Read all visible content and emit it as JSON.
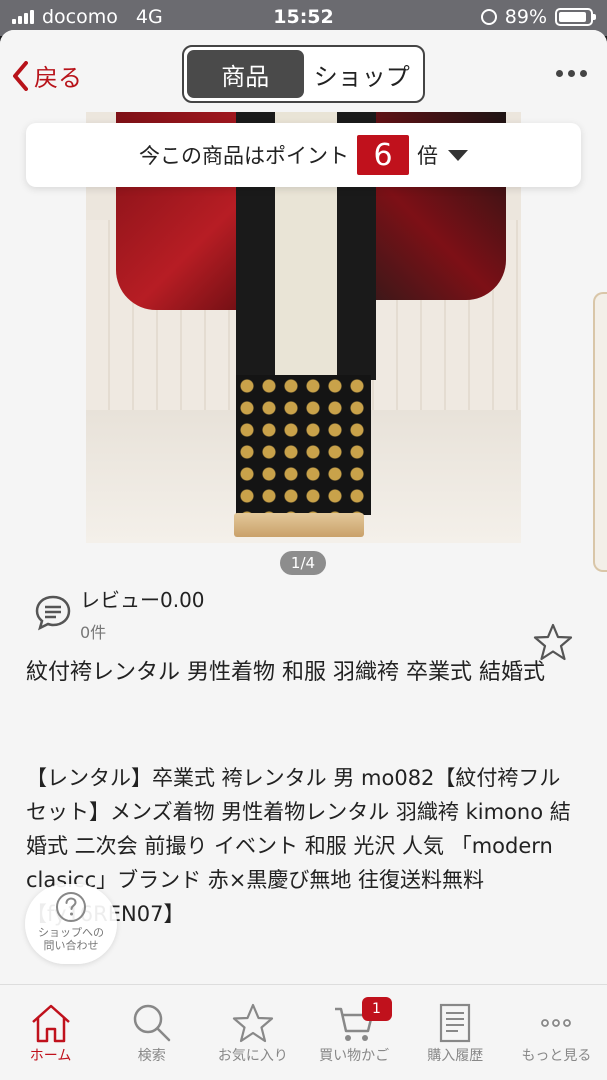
{
  "status_bar": {
    "carrier": "docomo",
    "network": "4G",
    "time": "15:52",
    "battery": "89%"
  },
  "header": {
    "back_label": "戻る",
    "segments": [
      "商品",
      "ショップ"
    ],
    "active_segment": "商品"
  },
  "points_banner": {
    "text": "今この商品はポイント",
    "multiplier": "6",
    "suffix": "倍"
  },
  "image_pager": "1/4",
  "review": {
    "label": "レビュー0.00",
    "count": "0件"
  },
  "product": {
    "title": "紋付袴レンタル 男性着物 和服 羽織袴 卒業式 結婚式",
    "description": "【レンタル】卒業式 袴レンタル 男 mo082【紋付袴フルセット】メンズ着物 男性着物レンタル 羽織袴 kimono 結婚式 二次会 前撮り イベント 和服 光沢 人気 「modern clasicc」ブランド 赤×黒慶び無地 往復送料無料【fy16REN07】"
  },
  "contact_button": {
    "line1": "ショップへの",
    "line2": "問い合わせ"
  },
  "tab_bar": {
    "items": [
      {
        "label": "ホーム",
        "icon": "home-icon"
      },
      {
        "label": "検索",
        "icon": "search-icon"
      },
      {
        "label": "お気に入り",
        "icon": "star-icon"
      },
      {
        "label": "買い物かご",
        "icon": "cart-icon"
      },
      {
        "label": "購入履歴",
        "icon": "receipt-icon"
      },
      {
        "label": "もっと見る",
        "icon": "more-icon"
      }
    ],
    "cart_badge": "1"
  },
  "colors": {
    "accent": "#c0111c",
    "segment_active": "#4a4a4a"
  }
}
